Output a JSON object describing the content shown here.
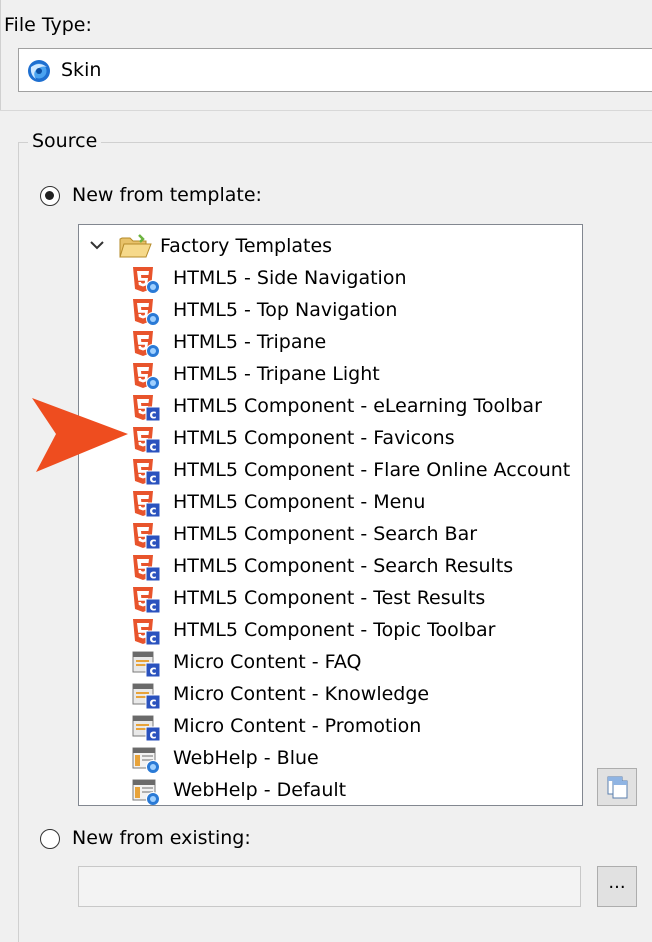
{
  "file_type": {
    "label": "File Type:",
    "value": "Skin",
    "icon": "skin-globe-icon"
  },
  "source": {
    "label": "Source",
    "option_template": {
      "label": "New from template:",
      "selected": true
    },
    "option_existing": {
      "label": "New from existing:",
      "selected": false
    },
    "existing_value": "",
    "browse_label": "..."
  },
  "tree": {
    "root": {
      "label": "Factory Templates",
      "expanded": true
    },
    "items": [
      {
        "label": "HTML5 - Side Navigation",
        "icon": "html5-skin-icon"
      },
      {
        "label": "HTML5 - Top Navigation",
        "icon": "html5-skin-icon"
      },
      {
        "label": "HTML5 - Tripane",
        "icon": "html5-skin-icon"
      },
      {
        "label": "HTML5 - Tripane Light",
        "icon": "html5-skin-icon"
      },
      {
        "label": "HTML5 Component - eLearning Toolbar",
        "icon": "html5-component-icon"
      },
      {
        "label": "HTML5 Component - Favicons",
        "icon": "html5-component-icon"
      },
      {
        "label": "HTML5 Component - Flare Online Account",
        "icon": "html5-component-icon"
      },
      {
        "label": "HTML5 Component - Menu",
        "icon": "html5-component-icon"
      },
      {
        "label": "HTML5 Component - Search Bar",
        "icon": "html5-component-icon"
      },
      {
        "label": "HTML5 Component - Search Results",
        "icon": "html5-component-icon"
      },
      {
        "label": "HTML5 Component - Test Results",
        "icon": "html5-component-icon"
      },
      {
        "label": "HTML5 Component - Topic Toolbar",
        "icon": "html5-component-icon"
      },
      {
        "label": "Micro Content - FAQ",
        "icon": "micro-content-icon"
      },
      {
        "label": "Micro Content - Knowledge",
        "icon": "micro-content-icon"
      },
      {
        "label": "Micro Content - Promotion",
        "icon": "micro-content-icon"
      },
      {
        "label": "WebHelp - Blue",
        "icon": "webhelp-icon"
      },
      {
        "label": "WebHelp - Default",
        "icon": "webhelp-icon"
      }
    ]
  },
  "colors": {
    "html5_orange": "#e8542c",
    "component_blue": "#2a52be",
    "pointer_orange": "#ee4d1f"
  }
}
